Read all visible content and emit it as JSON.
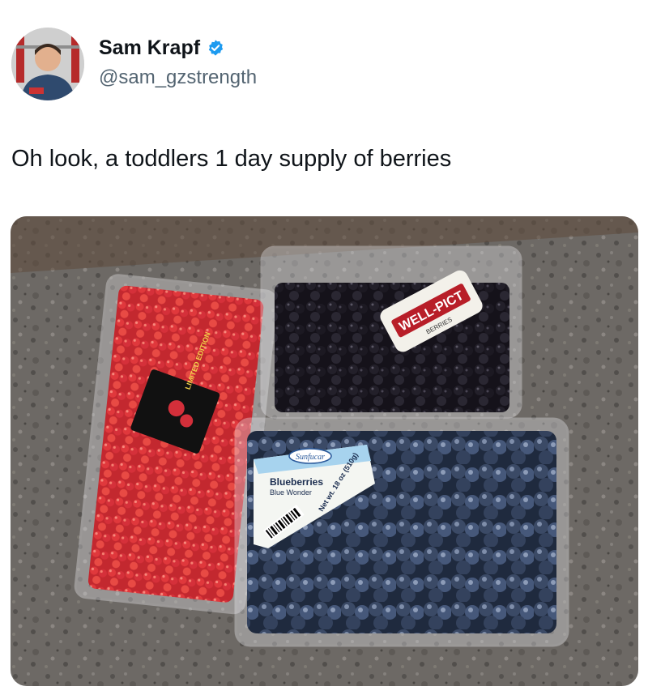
{
  "author": {
    "display_name": "Sam Krapf",
    "handle": "@sam_gzstrength",
    "verified": true,
    "verified_color": "#1d9bf0",
    "avatar_icon": "profile-photo"
  },
  "tweet": {
    "text": "Oh look, a toddlers 1 day supply of berries"
  },
  "media": {
    "description_icon": "photo-berries",
    "labels": {
      "raspberry_label": "LIMITED EDITION",
      "blackberry_brand": "WELL-PICT",
      "blackberry_sub": "BERRIES",
      "blueberry_brand": "Sunfucar",
      "blueberry_name": "Blueberries",
      "blueberry_variety": "Blue Wonder",
      "blueberry_weight": "Net wt. 18 oz (510g)"
    }
  }
}
